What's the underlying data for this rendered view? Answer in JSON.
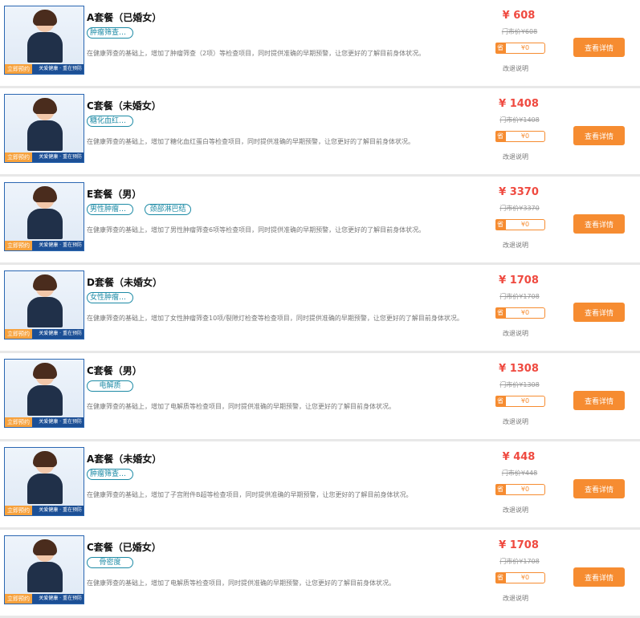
{
  "thumbnail": {
    "badge": "立即预约",
    "slogan": "关爱健康 · 重在预防"
  },
  "currency": "¥",
  "labels": {
    "market_prefix": "门市价",
    "save_label": "省",
    "rule": "改退说明",
    "detail": "查看详情"
  },
  "items": [
    {
      "title": "A套餐（已婚女）",
      "tags": [
        "肿瘤筛查（2..."
      ],
      "description": "在健康筛查的基础上，增加了肿瘤筛查（2项）等检查项目，同时提供准确的早期预警，让您更好的了解目前身体状况。",
      "price": "608",
      "market_price": "608",
      "saving": "0"
    },
    {
      "title": "C套餐（未婚女）",
      "tags": [
        "糖化血红蛋白"
      ],
      "description": "在健康筛查的基础上，增加了糖化血红蛋白等检查项目，同时提供准确的早期预警，让您更好的了解目前身体状况。",
      "price": "1408",
      "market_price": "1408",
      "saving": "0"
    },
    {
      "title": "E套餐（男）",
      "tags": [
        "男性肿瘤筛...",
        "颈部淋巴结"
      ],
      "description": "在健康筛查的基础上，增加了男性肿瘤筛查6项等检查项目，同时提供准确的早期预警，让您更好的了解目前身体状况。",
      "price": "3370",
      "market_price": "3370",
      "saving": "0"
    },
    {
      "title": "D套餐（未婚女）",
      "tags": [
        "女性肿瘤筛..."
      ],
      "description": "在健康筛查的基础上，增加了女性肿瘤筛查10项/裂隙灯检查等检查项目，同时提供准确的早期预警，让您更好的了解目前身体状况。",
      "price": "1708",
      "market_price": "1708",
      "saving": "0"
    },
    {
      "title": "C套餐（男）",
      "tags": [
        "电解质"
      ],
      "description": "在健康筛查的基础上，增加了电解质等检查项目，同时提供准确的早期预警，让您更好的了解目前身体状况。",
      "price": "1308",
      "market_price": "1308",
      "saving": "0"
    },
    {
      "title": "A套餐（未婚女）",
      "tags": [
        "肿瘤筛查（2..."
      ],
      "description": "在健康筛查的基础上，增加了子宫附件B超等检查项目，同时提供准确的早期预警，让您更好的了解目前身体状况。",
      "price": "448",
      "market_price": "448",
      "saving": "0"
    },
    {
      "title": "C套餐（已婚女）",
      "tags": [
        "骨密度"
      ],
      "description": "在健康筛查的基础上，增加了电解质等检查项目，同时提供准确的早期预警，让您更好的了解目前身体状况。",
      "price": "1708",
      "market_price": "1708",
      "saving": "0"
    }
  ]
}
